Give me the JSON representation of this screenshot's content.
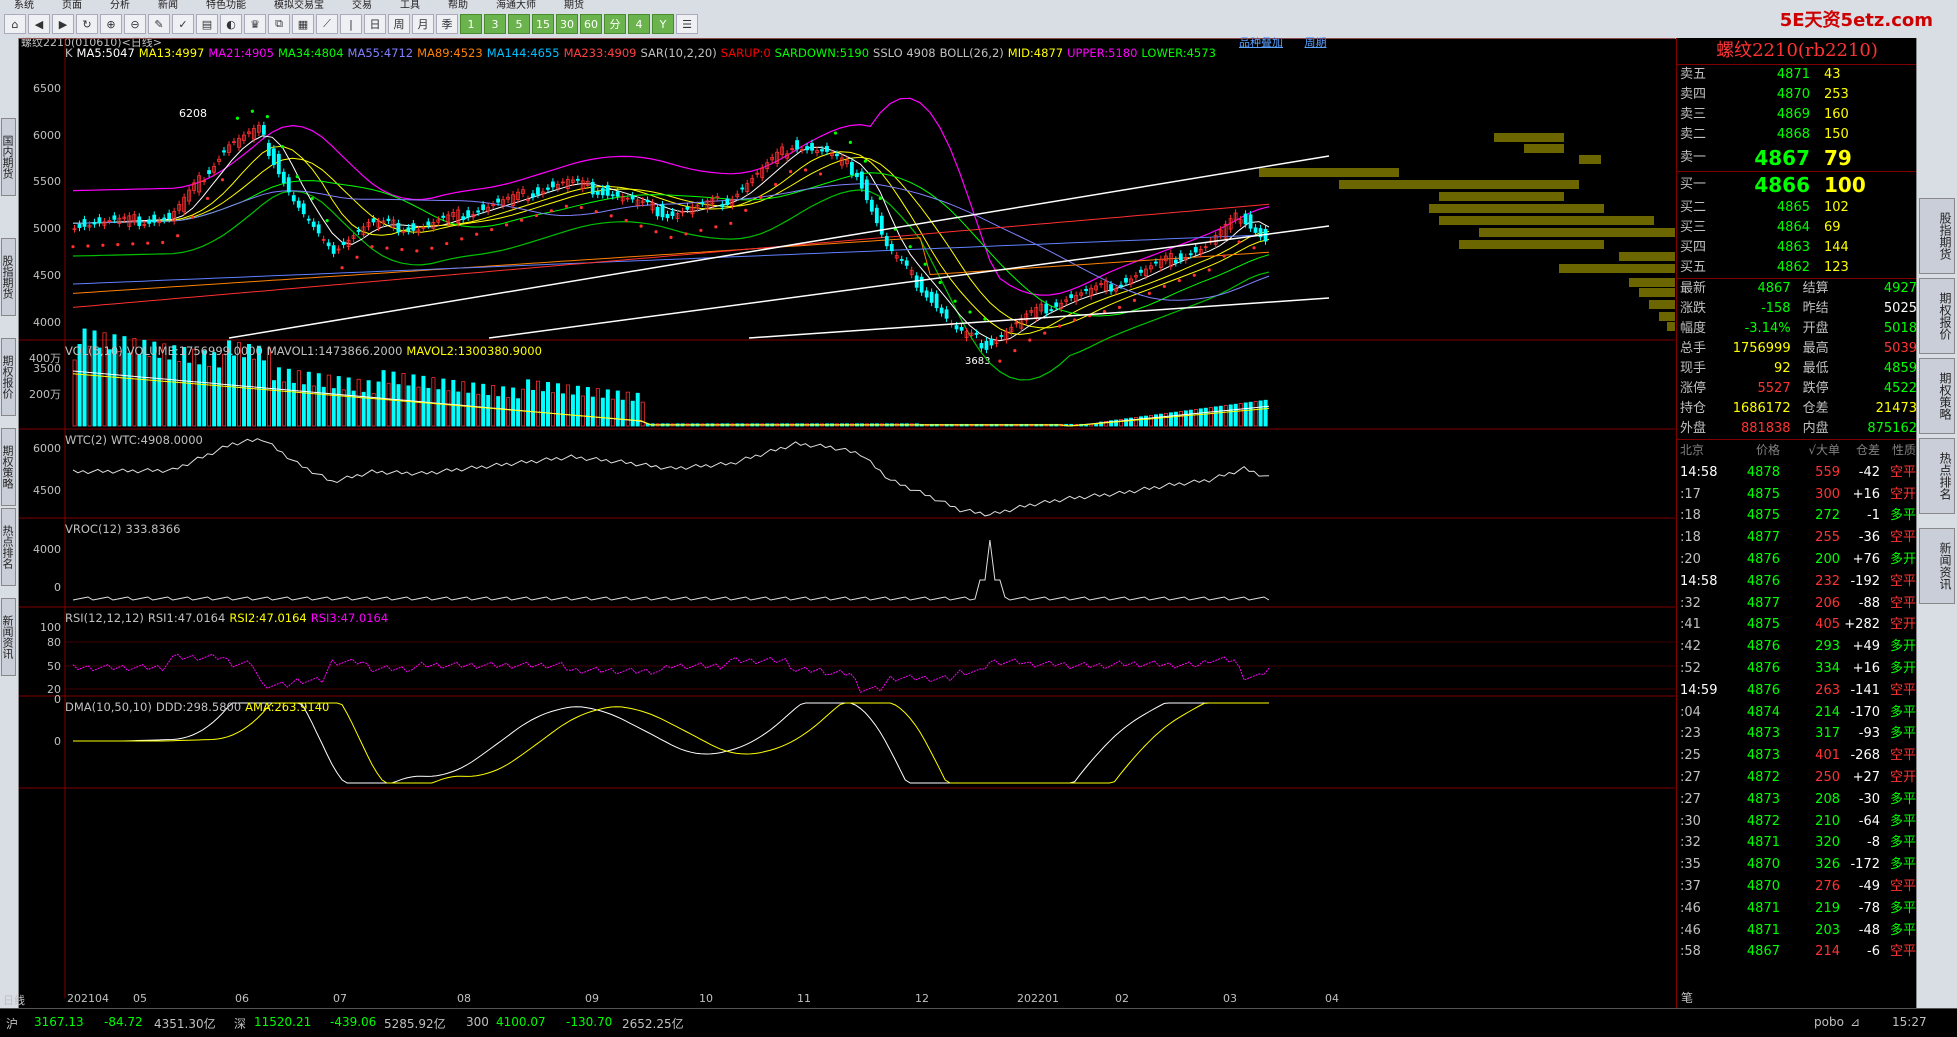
{
  "menu": [
    "系统",
    "页面",
    "分析",
    "新闻",
    "特色功能",
    "模拟交易宝",
    "交易",
    "工具",
    "帮助",
    "海通大师",
    "期货"
  ],
  "toolbar_buttons": [
    "home",
    "back",
    "fwd",
    "refresh",
    "zoom",
    "zoomout",
    "draw",
    "mark",
    "tick",
    "color",
    "cup",
    "chart",
    "grid",
    "line",
    "sep",
    "日",
    "周",
    "月",
    "季",
    "1",
    "3",
    "5",
    "15",
    "30",
    "60",
    "分",
    "4",
    "Y",
    "list"
  ],
  "brand": "5E天资5etz.com",
  "left_tabs": [
    "国内期货",
    "股指期货",
    "期权报价",
    "期权策略",
    "热点排名",
    "新闻资讯"
  ],
  "right_tabs": [
    "股指期货",
    "期权报价",
    "期权策略",
    "热点排名",
    "新闻资讯"
  ],
  "chart": {
    "header": "螺纹2210(010610)<日线>",
    "header_links": [
      "品种叠加",
      "周期"
    ],
    "main_legend": [
      {
        "text": "K",
        "color": "#c0c0c0"
      },
      {
        "text": "MA5:5047",
        "color": "#ffffff"
      },
      {
        "text": "MA13:4997",
        "color": "#ffff00"
      },
      {
        "text": "MA21:4905",
        "color": "#ff00ff"
      },
      {
        "text": "MA34:4804",
        "color": "#00ff00"
      },
      {
        "text": "MA55:4712",
        "color": "#8080ff"
      },
      {
        "text": "MA89:4523",
        "color": "#ff8000"
      },
      {
        "text": "MA144:4655",
        "color": "#00c0ff"
      },
      {
        "text": "MA233:4909",
        "color": "#ff4040"
      },
      {
        "text": "SAR(10,2,20)",
        "color": "#c0c0c0"
      },
      {
        "text": "SARUP:0",
        "color": "#ff0000"
      },
      {
        "text": "SARDOWN:5190",
        "color": "#00ff00"
      },
      {
        "text": "SSLO 4908",
        "color": "#c0c0c0"
      },
      {
        "text": "BOLL(26,2)",
        "color": "#c0c0c0"
      },
      {
        "text": "MID:4877",
        "color": "#ffff00"
      },
      {
        "text": "UPPER:5180",
        "color": "#ff00ff"
      },
      {
        "text": "LOWER:4573",
        "color": "#00ff00"
      }
    ],
    "price_ticks": [
      "6500",
      "6000",
      "5500",
      "5000",
      "4500",
      "4000",
      "3500"
    ],
    "price_high_label": "6208",
    "price_low_label": "3683",
    "vol_legend": [
      {
        "text": "VOL(5,10)",
        "color": "#c0c0c0"
      },
      {
        "text": "VOLUME:1756999.0000",
        "color": "#c0c0c0"
      },
      {
        "text": "MAVOL1:1473866.2000",
        "color": "#c0c0c0"
      },
      {
        "text": "MAVOL2:1300380.9000",
        "color": "#ffff00"
      }
    ],
    "vol_ticks": [
      "400万",
      "200万"
    ],
    "wtc_legend": [
      {
        "text": "WTC(2)",
        "color": "#c0c0c0"
      },
      {
        "text": "WTC:4908.0000",
        "color": "#c0c0c0"
      }
    ],
    "wtc_ticks": [
      "6000",
      "4500"
    ],
    "vroc_legend": [
      {
        "text": "VROC(12)",
        "color": "#c0c0c0"
      },
      {
        "text": "333.8366",
        "color": "#c0c0c0"
      }
    ],
    "vroc_ticks": [
      "4000",
      "0"
    ],
    "rsi_legend": [
      {
        "text": "RSI(12,12,12)",
        "color": "#c0c0c0"
      },
      {
        "text": "RSI1:47.0164",
        "color": "#c0c0c0"
      },
      {
        "text": "RSI2:47.0164",
        "color": "#ffff00"
      },
      {
        "text": "RSI3:47.0164",
        "color": "#ff00ff"
      }
    ],
    "rsi_ticks": [
      "100",
      "80",
      "50",
      "20",
      "0"
    ],
    "dma_legend": [
      {
        "text": "DMA(10,50,10)",
        "color": "#c0c0c0"
      },
      {
        "text": "DDD:298.5800",
        "color": "#c0c0c0"
      },
      {
        "text": "AMA:263.9140",
        "color": "#ffff00"
      }
    ],
    "dma_ticks": [
      "0"
    ],
    "date_label": "日线",
    "dates": [
      "202104",
      "05",
      "06",
      "07",
      "08",
      "09",
      "10",
      "11",
      "12",
      "202201",
      "02",
      "03",
      "04"
    ]
  },
  "quote": {
    "title": "螺纹2210(rb2210)",
    "asks": [
      {
        "label": "卖五",
        "price": "4871",
        "vol": "43"
      },
      {
        "label": "卖四",
        "price": "4870",
        "vol": "253"
      },
      {
        "label": "卖三",
        "price": "4869",
        "vol": "160"
      },
      {
        "label": "卖二",
        "price": "4868",
        "vol": "150"
      },
      {
        "label": "卖一",
        "price": "4867",
        "vol": "79"
      }
    ],
    "bids": [
      {
        "label": "买一",
        "price": "4866",
        "vol": "100"
      },
      {
        "label": "买二",
        "price": "4865",
        "vol": "102"
      },
      {
        "label": "买三",
        "price": "4864",
        "vol": "69"
      },
      {
        "label": "买四",
        "price": "4863",
        "vol": "144"
      },
      {
        "label": "买五",
        "price": "4862",
        "vol": "123"
      }
    ],
    "info": [
      [
        "最新",
        "4867",
        "结算",
        "4927"
      ],
      [
        "涨跌",
        "-158",
        "昨结",
        "5025"
      ],
      [
        "幅度",
        "-3.14%",
        "开盘",
        "5018"
      ],
      [
        "总手",
        "1756999",
        "最高",
        "5039"
      ],
      [
        "现手",
        "92",
        "最低",
        "4859"
      ],
      [
        "涨停",
        "5527",
        "跌停",
        "4522"
      ],
      [
        "持仓",
        "1686172",
        "仓差",
        "21473"
      ],
      [
        "外盘",
        "881838",
        "内盘",
        "875162"
      ]
    ],
    "tick_header": [
      "北京",
      "价格",
      "√大单",
      "仓差",
      "性质"
    ],
    "ticks": [
      [
        "14:58",
        "4878",
        "559",
        "-42",
        "空平"
      ],
      [
        ":17",
        "4875",
        "300",
        "+16",
        "空开"
      ],
      [
        ":18",
        "4875",
        "272",
        "-1",
        "多平"
      ],
      [
        ":18",
        "4877",
        "255",
        "-36",
        "空平"
      ],
      [
        ":20",
        "4876",
        "200",
        "+76",
        "多开"
      ],
      [
        "14:58",
        "4876",
        "232",
        "-192",
        "空平"
      ],
      [
        ":32",
        "4877",
        "206",
        "-88",
        "空平"
      ],
      [
        ":41",
        "4875",
        "405",
        "+282",
        "空开"
      ],
      [
        ":42",
        "4876",
        "293",
        "+49",
        "多开"
      ],
      [
        ":52",
        "4876",
        "334",
        "+16",
        "多开"
      ],
      [
        "14:59",
        "4876",
        "263",
        "-141",
        "空平"
      ],
      [
        ":04",
        "4874",
        "214",
        "-170",
        "多平"
      ],
      [
        ":23",
        "4873",
        "317",
        "-93",
        "多平"
      ],
      [
        ":25",
        "4873",
        "401",
        "-268",
        "空平"
      ],
      [
        ":27",
        "4872",
        "250",
        "+27",
        "空开"
      ],
      [
        ":27",
        "4873",
        "208",
        "-30",
        "多平"
      ],
      [
        ":30",
        "4872",
        "210",
        "-64",
        "多平"
      ],
      [
        ":32",
        "4871",
        "320",
        "-8",
        "多平"
      ],
      [
        ":35",
        "4870",
        "326",
        "-172",
        "多平"
      ],
      [
        ":37",
        "4870",
        "276",
        "-49",
        "空平"
      ],
      [
        ":46",
        "4871",
        "219",
        "-78",
        "多平"
      ],
      [
        ":46",
        "4871",
        "203",
        "-48",
        "多平"
      ],
      [
        ":58",
        "4867",
        "214",
        "-6",
        "空平"
      ]
    ],
    "footer_label": "笔"
  },
  "status": {
    "sh_label": "沪",
    "sh_index": "3167.13",
    "sh_change": "-84.72",
    "sh_amount": "4351.30亿",
    "sz_label": "深",
    "sz_index": "11520.21",
    "sz_change": "-439.06",
    "sz_amount": "5285.92亿",
    "h300_label": "300",
    "h300_index": "4100.07",
    "h300_change": "-130.70",
    "h300_amount": "2652.25亿",
    "server": "pobo",
    "time": "15:27"
  }
}
